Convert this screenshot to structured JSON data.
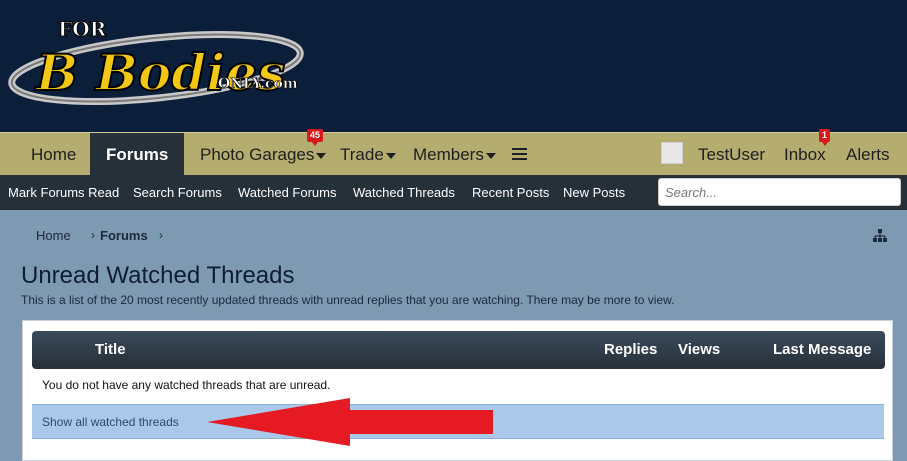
{
  "colors": {
    "header_bg": "#0c1f3a",
    "nav_bg": "#b5ac70",
    "subnav_bg": "#263039",
    "badge": "#d7191c",
    "highlight_row": "#a9c8ea",
    "arrow": "#e51a23"
  },
  "logo": {
    "line1": "FOR",
    "line2": "B Bodies",
    "line3": "ONLY.com"
  },
  "nav": {
    "home": "Home",
    "forums": "Forums",
    "photo_garages": "Photo Garages",
    "photo_garages_badge": "45",
    "trade": "Trade",
    "members": "Members",
    "user": "TestUser",
    "inbox": "Inbox",
    "inbox_badge": "1",
    "alerts": "Alerts"
  },
  "subnav": {
    "items": [
      "Mark Forums Read",
      "Search Forums",
      "Watched Forums",
      "Watched Threads",
      "Recent Posts",
      "New Posts"
    ],
    "search_placeholder": "Search..."
  },
  "breadcrumb": [
    "Home",
    "Forums"
  ],
  "page": {
    "title": "Unread Watched Threads",
    "description": "This is a list of the 20 most recently updated threads with unread replies that you are watching. There may be more to view."
  },
  "table": {
    "columns": [
      "Title",
      "Replies",
      "Views",
      "Last Message"
    ],
    "empty_message": "You do not have any watched threads that are unread.",
    "show_all_link": "Show all watched threads"
  }
}
